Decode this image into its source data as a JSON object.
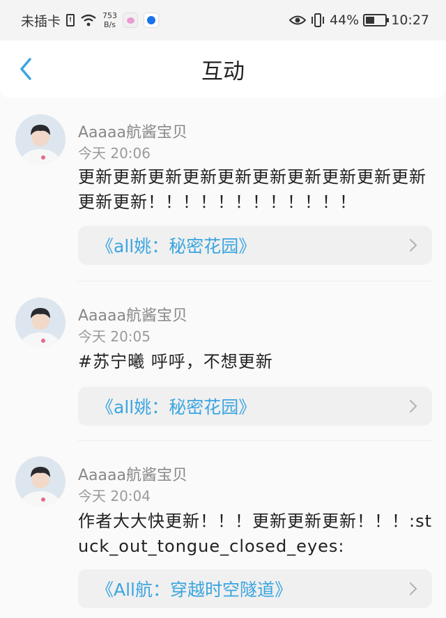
{
  "status_bar": {
    "carrier": "未插卡",
    "sim_icon": "sim-missing-icon",
    "speed_value": "753",
    "speed_unit": "B/s",
    "battery_percent": "44%",
    "time": "10:27"
  },
  "header": {
    "title": "互动",
    "back_icon": "chevron-left-icon"
  },
  "colors": {
    "accent": "#3aa5e0",
    "text": "#222222",
    "muted": "#9a9a9a",
    "card": "#f0f0f0"
  },
  "posts": [
    {
      "username": "Aaaaa航酱宝贝",
      "time": "今天 20:06",
      "content": "更新更新更新更新更新更新更新更新更新更新更新更新！！！！！！！！！！！！",
      "book": "《all姚：秘密花园》"
    },
    {
      "username": "Aaaaa航酱宝贝",
      "time": "今天 20:05",
      "content": "#苏宁曦  呼呼，不想更新",
      "book": "《all姚：秘密花园》"
    },
    {
      "username": "Aaaaa航酱宝贝",
      "time": "今天 20:04",
      "content": "作者大大快更新！！！更新更新更新！！！:stuck_out_tongue_closed_eyes:",
      "book": "《All航：穿越时空隧道》"
    }
  ]
}
